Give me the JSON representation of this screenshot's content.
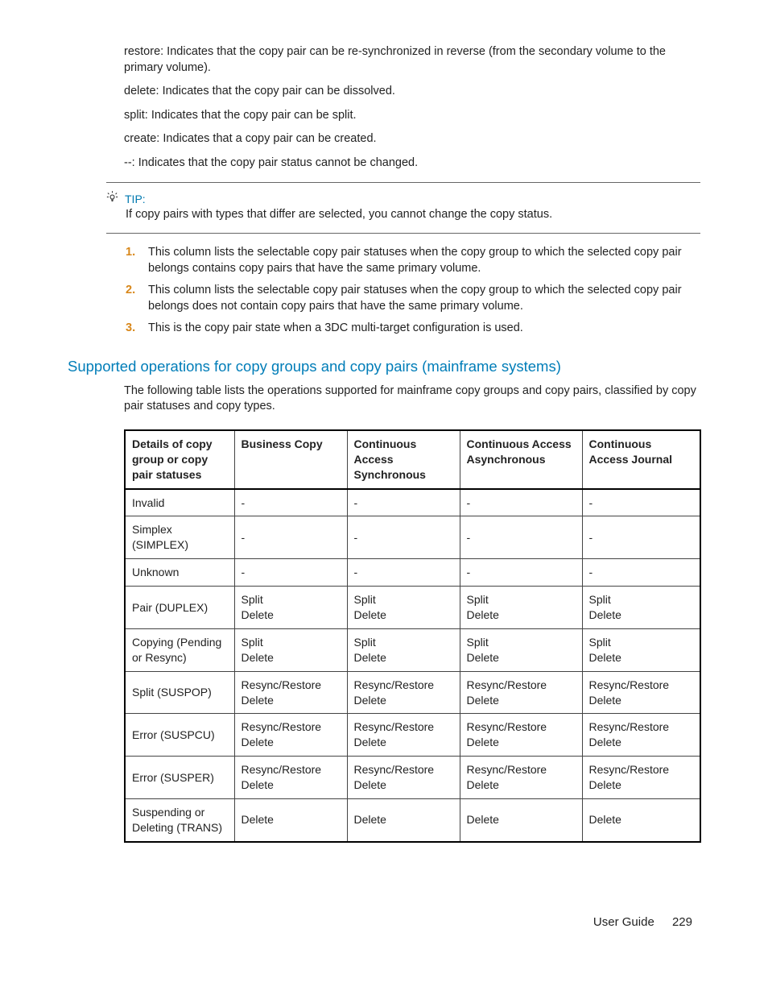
{
  "definitions": {
    "restore": "restore: Indicates that the copy pair can be re-synchronized in reverse (from the secondary volume to the primary volume).",
    "delete": "delete: Indicates that the copy pair can be dissolved.",
    "split": "split: Indicates that the copy pair can be split.",
    "create": "create: Indicates that a copy pair can be created.",
    "dashes": "--: Indicates that the copy pair status cannot be changed."
  },
  "tip": {
    "label": "TIP:",
    "text": "If copy pairs with types that differ are selected, you cannot change the copy status."
  },
  "notes": {
    "n1": "This column lists the selectable copy pair statuses when the copy group to which the selected copy pair belongs contains copy pairs that have the same primary volume.",
    "n2": "This column lists the selectable copy pair statuses when the copy group to which the selected copy pair belongs does not contain copy pairs that have the same primary volume.",
    "n3": "This is the copy pair state when a 3DC multi-target configuration is used."
  },
  "section": {
    "heading": "Supported operations for copy groups and copy pairs (mainframe systems)",
    "intro": "The following table lists the operations supported for mainframe copy groups and copy pairs, classified by copy pair statuses and copy types."
  },
  "table": {
    "headers": {
      "c1": "Details of copy group or copy pair statuses",
      "c2": "Business Copy",
      "c3": "Continuous Access Synchronous",
      "c4": "Continuous Access Asynchronous",
      "c5": "Continuous Access Journal"
    },
    "rows": [
      {
        "c1": "Invalid",
        "c2": "-",
        "c3": "-",
        "c4": "-",
        "c5": "-"
      },
      {
        "c1": "Simplex (SIMPLEX)",
        "c2": "-",
        "c3": "-",
        "c4": "-",
        "c5": "-"
      },
      {
        "c1": "Unknown",
        "c2": "-",
        "c3": "-",
        "c4": "-",
        "c5": "-"
      },
      {
        "c1": "Pair (DUPLEX)",
        "c2": "Split\nDelete",
        "c3": "Split\nDelete",
        "c4": "Split\nDelete",
        "c5": "Split\nDelete"
      },
      {
        "c1": "Copying (Pending or Resync)",
        "c2": "Split\nDelete",
        "c3": "Split\nDelete",
        "c4": "Split\nDelete",
        "c5": "Split\nDelete"
      },
      {
        "c1": "Split (SUSPOP)",
        "c2": "Resync/Restore\nDelete",
        "c3": "Resync/Restore\nDelete",
        "c4": "Resync/Restore\nDelete",
        "c5": "Resync/Restore\nDelete"
      },
      {
        "c1": "Error (SUSPCU)",
        "c2": "Resync/Restore\nDelete",
        "c3": "Resync/Restore\nDelete",
        "c4": "Resync/Restore\nDelete",
        "c5": "Resync/Restore\nDelete"
      },
      {
        "c1": "Error (SUSPER)",
        "c2": "Resync/Restore\nDelete",
        "c3": "Resync/Restore\nDelete",
        "c4": "Resync/Restore\nDelete",
        "c5": "Resync/Restore\nDelete"
      },
      {
        "c1": "Suspending or Deleting (TRANS)",
        "c2": "Delete",
        "c3": "Delete",
        "c4": "Delete",
        "c5": "Delete"
      }
    ]
  },
  "footer": {
    "title": "User Guide",
    "page": "229"
  }
}
